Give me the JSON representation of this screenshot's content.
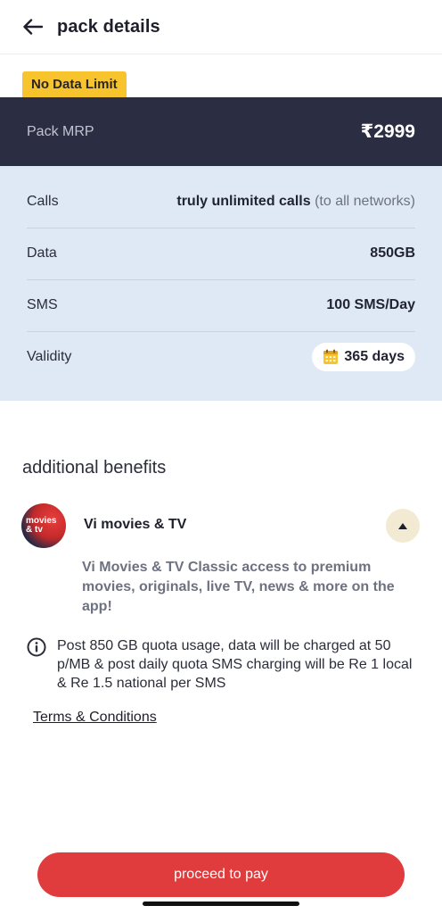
{
  "header": {
    "title": "pack details",
    "back_icon": "arrow-left-icon"
  },
  "badge": {
    "label": "No Data Limit",
    "color": "#f7c42e"
  },
  "mrp": {
    "label": "Pack MRP",
    "value": "₹2999",
    "bg_color": "#2b2d42"
  },
  "details": {
    "calls": {
      "label": "Calls",
      "value": "truly unlimited calls",
      "note": "(to all networks)"
    },
    "data": {
      "label": "Data",
      "value": "850GB"
    },
    "sms": {
      "label": "SMS",
      "value": "100 SMS/Day"
    },
    "validity": {
      "label": "Validity",
      "value": "365 days",
      "icon": "calendar-icon"
    }
  },
  "benefits": {
    "title": "additional benefits",
    "items": [
      {
        "logo_line1": "movies",
        "logo_line2": "& tv",
        "name": "Vi movies & TV",
        "description": "Vi Movies & TV Classic access to premium movies, originals, live TV, news & more on the app!",
        "toggle_icon": "caret-up-icon"
      }
    ]
  },
  "info": {
    "icon": "info-icon",
    "text": "Post  850 GB quota usage, data will be charged at 50 p/MB & post daily quota SMS charging will be Re 1 local & Re 1.5 national per SMS"
  },
  "terms": {
    "label": "Terms & Conditions"
  },
  "cta": {
    "label": "proceed to pay",
    "color": "#e03b3d"
  }
}
